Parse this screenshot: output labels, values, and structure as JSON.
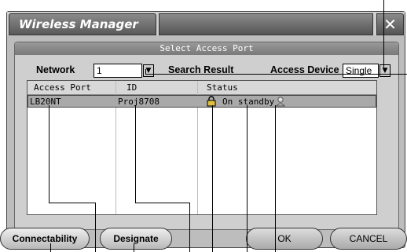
{
  "window": {
    "title": "Wireless Manager",
    "close_glyph": "✕"
  },
  "panel": {
    "header": "Select Access Port"
  },
  "network": {
    "label": "Network",
    "value": "1"
  },
  "search_result_label": "Search Result",
  "access_device": {
    "label": "Access Device",
    "value": "Single"
  },
  "list": {
    "columns": [
      "Access Port",
      "ID",
      "Status"
    ],
    "rows": [
      {
        "access_port": "LB20NT",
        "id": "Proj8708",
        "status": "On standby",
        "lock_icon": "lock-icon",
        "status_icon": "user-icon"
      }
    ]
  },
  "buttons": {
    "connectability": "Connectability",
    "designate": "Designate",
    "ok": "OK",
    "cancel": "CANCEL"
  },
  "colors": {
    "title_bar": "#5a5a5a",
    "panel": "#cfcfcf",
    "selected_row": "#a9a9a9"
  }
}
